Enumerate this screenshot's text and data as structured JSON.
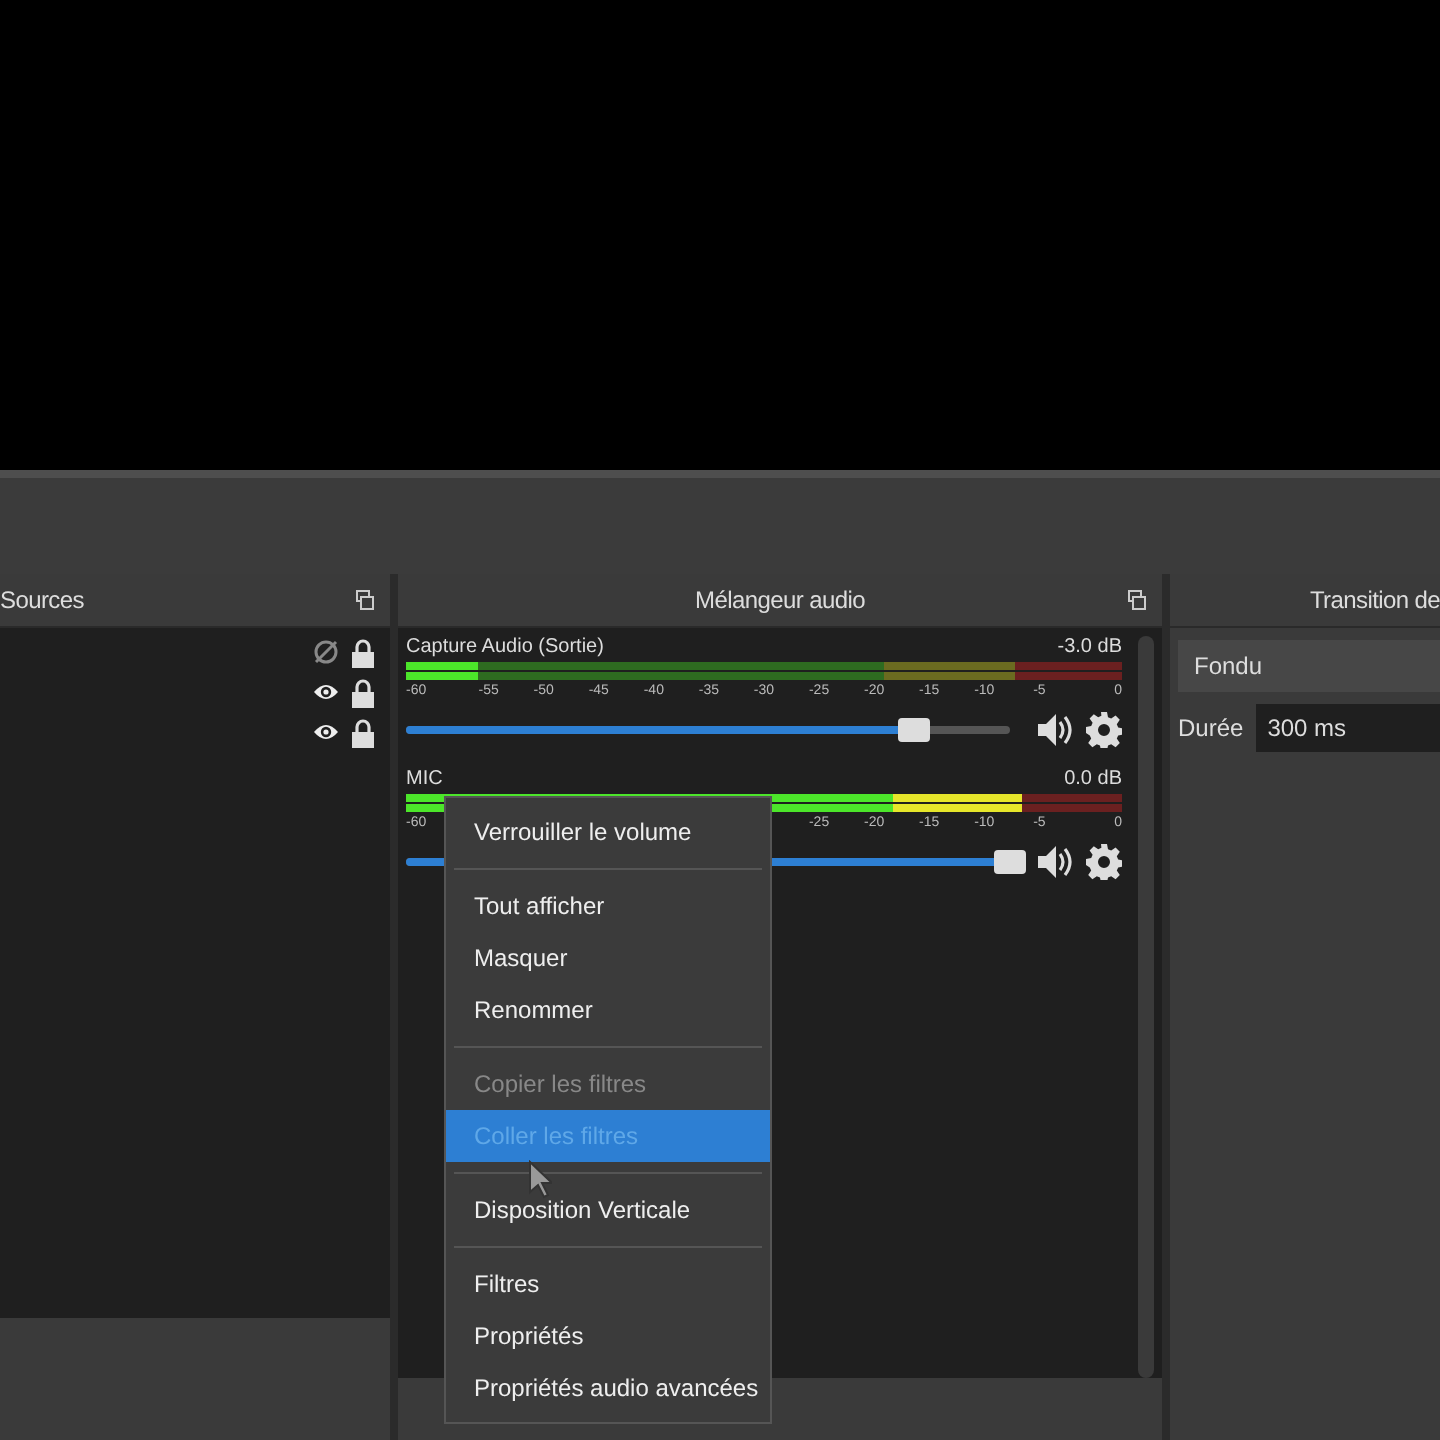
{
  "sources_dock": {
    "title": "Sources",
    "rows": [
      {
        "visible": false,
        "locked": true
      },
      {
        "visible": true,
        "locked": true
      },
      {
        "visible": true,
        "locked": true
      }
    ]
  },
  "mixer_dock": {
    "title": "Mélangeur audio",
    "channels": [
      {
        "name": "Capture Audio (Sortie)",
        "reading": "-3.0 dB",
        "meter": {
          "level": 0.1
        },
        "slider": {
          "level": 0.84
        },
        "scale": [
          "-60",
          "-55",
          "-50",
          "-45",
          "-40",
          "-35",
          "-30",
          "-25",
          "-20",
          "-15",
          "-10",
          "-5",
          "0"
        ]
      },
      {
        "name": "MIC",
        "reading": "0.0 dB",
        "meter": {
          "level": 0.86
        },
        "slider": {
          "level": 1.0
        },
        "scale": [
          "-60",
          "-25",
          "-20",
          "-15",
          "-10",
          "-5",
          "0"
        ]
      }
    ]
  },
  "transition_dock": {
    "title": "Transition de",
    "transition": "Fondu",
    "duration_label": "Durée",
    "duration": "300 ms"
  },
  "context_menu": [
    {
      "kind": "item",
      "label": "Verrouiller le volume",
      "disabled": false,
      "selected": false
    },
    {
      "kind": "separator"
    },
    {
      "kind": "item",
      "label": "Tout afficher",
      "disabled": false,
      "selected": false
    },
    {
      "kind": "item",
      "label": "Masquer",
      "disabled": false,
      "selected": false
    },
    {
      "kind": "item",
      "label": "Renommer",
      "disabled": false,
      "selected": false
    },
    {
      "kind": "separator"
    },
    {
      "kind": "item",
      "label": "Copier les filtres",
      "disabled": true,
      "selected": false
    },
    {
      "kind": "item",
      "label": "Coller les filtres",
      "disabled": true,
      "selected": true
    },
    {
      "kind": "separator"
    },
    {
      "kind": "item",
      "label": "Disposition Verticale",
      "disabled": false,
      "selected": false
    },
    {
      "kind": "separator"
    },
    {
      "kind": "item",
      "label": "Filtres",
      "disabled": false,
      "selected": false
    },
    {
      "kind": "item",
      "label": "Propriétés",
      "disabled": false,
      "selected": false
    },
    {
      "kind": "item",
      "label": "Propriétés audio avancées",
      "disabled": false,
      "selected": false
    }
  ]
}
